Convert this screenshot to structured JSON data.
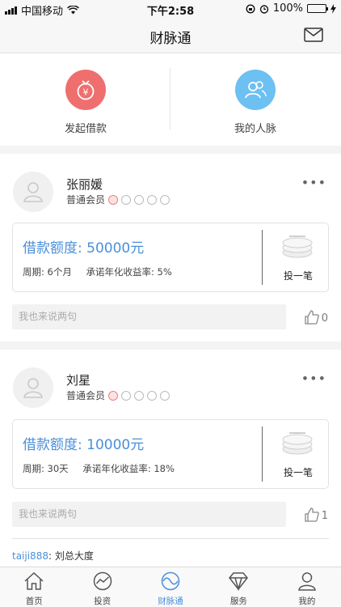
{
  "status": {
    "carrier": "中国移动",
    "time": "下午2:58",
    "battery": "100%"
  },
  "nav": {
    "title": "财脉通"
  },
  "quick": {
    "start_loan": "发起借款",
    "my_network": "我的人脉"
  },
  "posts": [
    {
      "name": "张丽媛",
      "member": "普通会员",
      "amount_label": "借款额度: 50000元",
      "term": "周期: 6个月",
      "rate": "承诺年化收益率: 5%",
      "invest_label": "投一笔",
      "comment_placeholder": "我也来说两句",
      "likes": "0"
    },
    {
      "name": "刘星",
      "member": "普通会员",
      "amount_label": "借款额度: 10000元",
      "term": "周期: 30天",
      "rate": "承诺年化收益率: 18%",
      "invest_label": "投一笔",
      "comment_placeholder": "我也来说两句",
      "likes": "1",
      "comments": [
        {
          "user": "taiji888",
          "text": ": 刘总大度"
        }
      ]
    }
  ],
  "tabs": [
    {
      "label": "首页",
      "icon": "home-icon"
    },
    {
      "label": "投资",
      "icon": "chart-icon"
    },
    {
      "label": "财脉通",
      "icon": "network-icon"
    },
    {
      "label": "服务",
      "icon": "diamond-icon"
    },
    {
      "label": "我的",
      "icon": "person-icon"
    }
  ],
  "colors": {
    "accent": "#4a90d9",
    "loan_red": "#ef6f6f",
    "network_blue": "#6cc0f2"
  }
}
